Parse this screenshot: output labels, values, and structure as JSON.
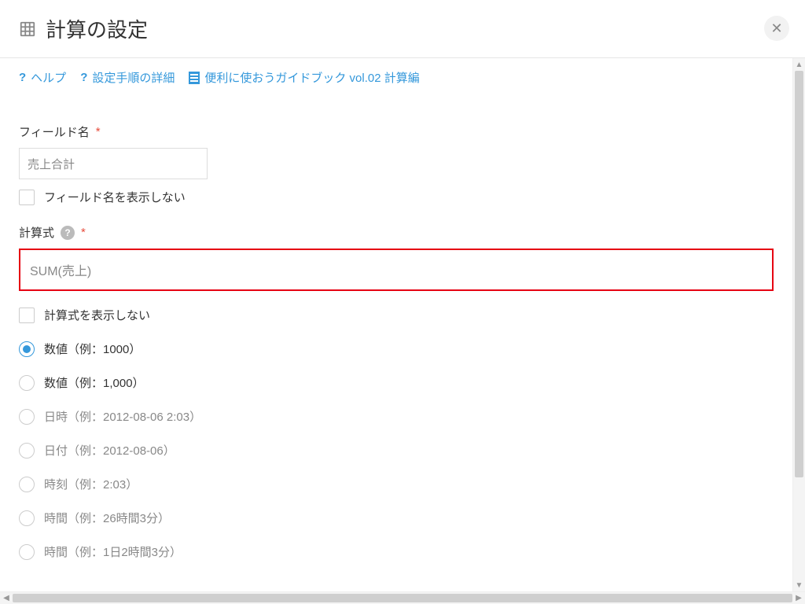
{
  "header": {
    "title": "計算の設定"
  },
  "help": {
    "help": "ヘルプ",
    "detail": "設定手順の詳細",
    "guide": "便利に使おうガイドブック vol.02 計算編"
  },
  "fields": {
    "fieldNameLabel": "フィールド名",
    "fieldNameValue": "売上合計",
    "hideFieldName": "フィールド名を表示しない",
    "formulaLabel": "計算式",
    "formulaValue": "SUM(売上)",
    "hideFormula": "計算式を表示しない"
  },
  "formatOptions": [
    {
      "label": "数値（例：1000）",
      "checked": true,
      "disabled": false
    },
    {
      "label": "数値（例：1,000）",
      "checked": false,
      "disabled": false
    },
    {
      "label": "日時（例：2012-08-06 2:03）",
      "checked": false,
      "disabled": true
    },
    {
      "label": "日付（例：2012-08-06）",
      "checked": false,
      "disabled": true
    },
    {
      "label": "時刻（例：2:03）",
      "checked": false,
      "disabled": true
    },
    {
      "label": "時間（例：26時間3分）",
      "checked": false,
      "disabled": true
    },
    {
      "label": "時間（例：1日2時間3分）",
      "checked": false,
      "disabled": true
    }
  ]
}
